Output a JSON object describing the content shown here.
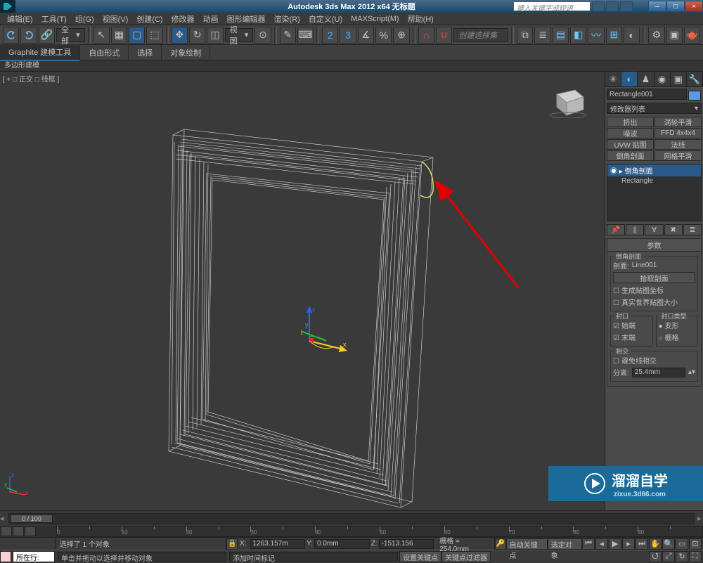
{
  "title_bar": {
    "app_title": "Autodesk 3ds Max  2012  x64    无标题",
    "search_placeholder": "键入关键字或短语"
  },
  "menu": [
    "编辑(E)",
    "工具(T)",
    "组(G)",
    "视图(V)",
    "创建(C)",
    "修改器",
    "动画",
    "图形编辑器",
    "渲染(R)",
    "自定义(U)",
    "MAXScript(M)",
    "帮助(H)"
  ],
  "ribbon": {
    "title": "Graphite 建模工具",
    "tabs": [
      "自由形式",
      "选择",
      "对象绘制"
    ],
    "sub": "多边形建模"
  },
  "toolbar": {
    "all_flyout": "全部",
    "view_flyout": "视图",
    "selset": "创建选择集"
  },
  "viewport": {
    "label": "[ + □ 正交 □ 线框 ]"
  },
  "cmd_panel": {
    "obj_name": "Rectangle001",
    "modifier_list": "修改器列表",
    "mod_buttons": [
      "挤出",
      "涡轮平滑",
      "噪波",
      "FFD 4x4x4",
      "UVW 贴图",
      "法线",
      "倒角剖面",
      "网格平滑"
    ],
    "stack": [
      {
        "label": "倒角剖面",
        "sub": true,
        "selected": true,
        "expand": "◉ ▸"
      },
      {
        "label": "Rectangle",
        "sub": false,
        "selected": false
      }
    ],
    "params": {
      "title": "参数",
      "bevel_section_group": "倒角剖面",
      "profile_label": "剖面:",
      "profile_value": "Line001",
      "pick_profile": "拾取剖面",
      "gen_map_coords": "生成贴图坐标",
      "real_world": "真实世界贴图大小",
      "cap_group": "封口",
      "cap_type_group": "封口类型",
      "cap_start": "始端",
      "cap_end": "末端",
      "cap_morph": "变形",
      "cap_grid": "栅格",
      "intersect_group": "相交",
      "avoid_intersect": "避免线相交",
      "separation_label": "分离:",
      "separation_value": "25.4mm"
    }
  },
  "timeline": {
    "frame_indicator": "0 / 100"
  },
  "status": {
    "selected_msg": "选择了 1 个对象",
    "prompt": "单击并拖动以选择并移动对象",
    "prompt2": "添加时间标记",
    "x_val": "1263.157m",
    "y_val": "0.0mm",
    "z_val": "-1513.156",
    "grid_label": "栅格 = 254.0mm",
    "auto_key": "自动关键点",
    "set_key": "设置关键点",
    "sel_obj": "选定对象",
    "key_filter": "关键点过滤器",
    "listener_label": "所在行:"
  },
  "watermark": {
    "text": "溜溜自学",
    "url": "zixue.3d66.com"
  }
}
